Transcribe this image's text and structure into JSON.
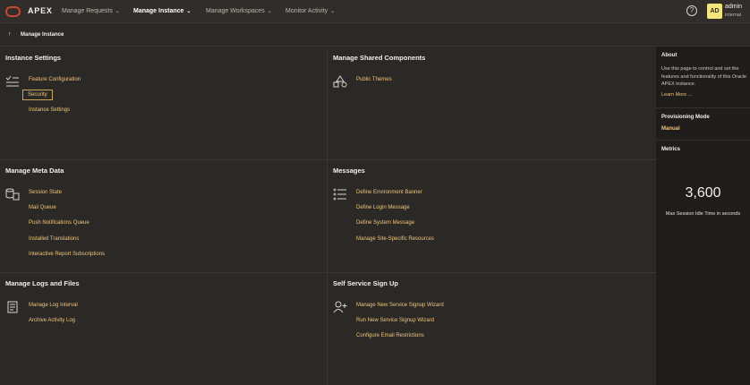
{
  "app": {
    "brand": "APEX"
  },
  "nav": {
    "items": [
      {
        "label": "Manage Requests"
      },
      {
        "label": "Manage Instance"
      },
      {
        "label": "Manage Workspaces"
      },
      {
        "label": "Monitor Activity"
      }
    ],
    "caret": "⌄",
    "help": "?",
    "user": {
      "initials": "AD",
      "name": "admin",
      "workspace": "internal"
    }
  },
  "breadcrumb": {
    "up_icon": "↑",
    "label": "Manage Instance"
  },
  "regions": {
    "instance_settings": {
      "title": "Instance Settings",
      "links": [
        "Feature Configuration",
        "Security",
        "Instance Settings"
      ]
    },
    "shared_components": {
      "title": "Manage Shared Components",
      "links": [
        "Public Themes"
      ]
    },
    "meta_data": {
      "title": "Manage Meta Data",
      "links": [
        "Session State",
        "Mail Queue",
        "Push Notifications Queue",
        "Installed Translations",
        "Interactive Report Subscriptions"
      ]
    },
    "messages": {
      "title": "Messages",
      "links": [
        "Define Environment Banner",
        "Define Login Message",
        "Define System Message",
        "Manage Site-Specific Resources"
      ]
    },
    "logs": {
      "title": "Manage Logs and Files",
      "links": [
        "Manage Log Interval",
        "Archive Activity Log"
      ]
    },
    "self_service": {
      "title": "Self Service Sign Up",
      "links": [
        "Manage New Service Signup Wizard",
        "Run New Service Signup Wizard",
        "Configure Email Restrictions"
      ]
    }
  },
  "sidebar": {
    "about": {
      "heading": "About",
      "text": "Use this page to control and set the features and functionality of this Oracle APEX instance.",
      "link": "Learn More ..."
    },
    "provisioning": {
      "heading": "Provisioning Mode",
      "value": "Manual"
    },
    "metrics": {
      "heading": "Metrics",
      "value": "3,600",
      "label": "Max Session Idle Time in seconds"
    }
  }
}
